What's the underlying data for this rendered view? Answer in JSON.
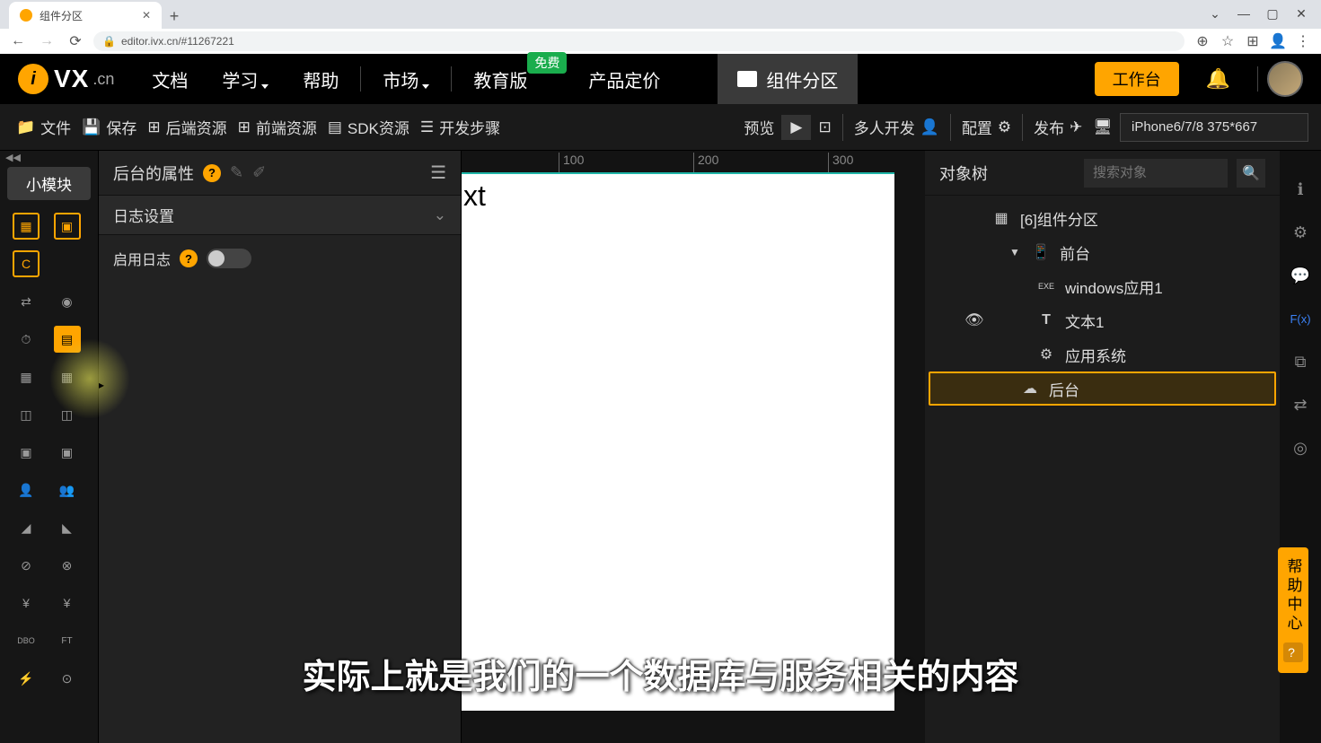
{
  "browser": {
    "tab_title": "组件分区",
    "url": "editor.ivx.cn/#11267221"
  },
  "topnav": {
    "logo": "VX",
    "logo_suffix": ".cn",
    "items": {
      "docs": "文档",
      "learn": "学习",
      "help": "帮助",
      "market": "市场",
      "edu": "教育版",
      "edu_badge": "免费",
      "pricing": "产品定价"
    },
    "active_tab": "组件分区",
    "workspace": "工作台"
  },
  "toolbar": {
    "file": "文件",
    "save": "保存",
    "backend_res": "后端资源",
    "frontend_res": "前端资源",
    "sdk_res": "SDK资源",
    "dev_steps": "开发步骤",
    "preview": "预览",
    "multi_dev": "多人开发",
    "config": "配置",
    "publish": "发布",
    "device": "iPhone6/7/8 375*667"
  },
  "left_rail": {
    "tab": "小模块"
  },
  "props": {
    "title": "后台的属性",
    "section": "日志设置",
    "enable_log": "启用日志"
  },
  "ruler": {
    "t100": "100",
    "t200": "200",
    "t300": "300"
  },
  "canvas": {
    "text": "xt"
  },
  "tree": {
    "title": "对象树",
    "search_placeholder": "搜索对象",
    "nodes": {
      "root": "[6]组件分区",
      "front": "前台",
      "winapp": "windows应用1",
      "text1": "文本1",
      "appsys": "应用系统",
      "back": "后台"
    }
  },
  "help_center": "帮助中心",
  "subtitle": "实际上就是我们的一个数据库与服务相关的内容"
}
